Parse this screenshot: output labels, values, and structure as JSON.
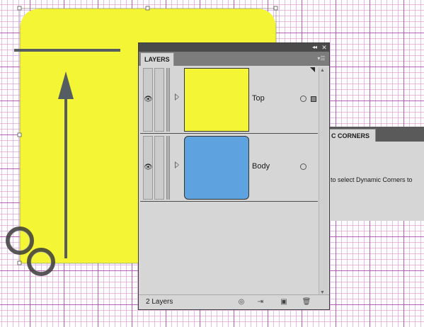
{
  "colors": {
    "shape_fill": "#f4f535",
    "body_thumb": "#5ea3e0",
    "arrow": "#555d63",
    "grid_major": "#b75fb7",
    "grid_minor": "#e6b8e6",
    "panel_bg": "#d6d6d6"
  },
  "dynamic_corners_panel": {
    "tab_label": "C CORNERS",
    "body_text": "to select Dynamic Corners to"
  },
  "layers_panel": {
    "tab_label": "LAYERS",
    "collapse_icon": "double-chevron-left-icon",
    "close_icon": "close-icon",
    "menu_icon": "panel-menu-icon",
    "layers": [
      {
        "name": "Top",
        "thumb_color": "#f4f535",
        "selected": true
      },
      {
        "name": "Body",
        "thumb_color": "#5ea3e0",
        "selected": false
      }
    ],
    "footer": {
      "layer_count": "2 Layers",
      "buttons": [
        "locate-object-icon",
        "make-clipping-mask-icon",
        "new-sublayer-icon",
        "new-layer-icon",
        "trash-icon"
      ]
    }
  }
}
